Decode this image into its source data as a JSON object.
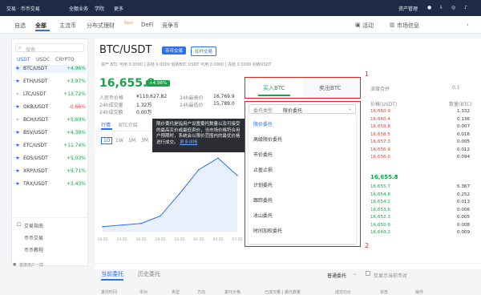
{
  "topnav": {
    "brand": "交易 · 币币交易",
    "items": [
      "全额业务",
      "学院",
      "更多"
    ],
    "right": [
      "资产管理"
    ]
  },
  "subnav": {
    "tabs": [
      "自选",
      "全部",
      "主流币",
      "分布式理财",
      "DeFi",
      "竞争币"
    ],
    "active": "全部",
    "badge_new": "New",
    "right": [
      "活动",
      "市场信息"
    ]
  },
  "market_list": {
    "search_placeholder": "搜索",
    "filters": [
      "USDT",
      "USDC",
      "CRYPTO"
    ],
    "rows": [
      {
        "sym": "BTC/USDT",
        "chg": "+4.96%",
        "dir": "up",
        "active": true,
        "starred": true
      },
      {
        "sym": "ETH/USDT",
        "chg": "+3.97%",
        "dir": "up",
        "starred": true
      },
      {
        "sym": "LTC/USDT",
        "chg": "+13.72%",
        "dir": "up"
      },
      {
        "sym": "OKB/USDT",
        "chg": "-0.66%",
        "dir": "down",
        "starred": true
      },
      {
        "sym": "BCH/USDT",
        "chg": "+5.69%",
        "dir": "up"
      },
      {
        "sym": "BSV/USDT",
        "chg": "+4.38%",
        "dir": "up",
        "starred": true
      },
      {
        "sym": "ETC/USDT",
        "chg": "+11.74%",
        "dir": "up",
        "starred": true
      },
      {
        "sym": "EOS/USDT",
        "chg": "+5.03%",
        "dir": "up",
        "starred": true
      },
      {
        "sym": "XRP/USDT",
        "chg": "+9.71%",
        "dir": "up",
        "starred": true
      },
      {
        "sym": "TRX/USDT",
        "chg": "+3.43%",
        "dir": "up",
        "starred": true
      }
    ],
    "footer_title": "交易指南",
    "footer_links": [
      "币币交易",
      "币币教程"
    ]
  },
  "header": {
    "pair": "BTC/USDT",
    "tag1": "币币交易",
    "tag2": "杠杆交易",
    "asset_line": "资产    BTC  可用 0.0000 | 冻结 0.0000  划转BTC    USDT  可用 0.0000 | 冻结 0.0000  划转USDT",
    "price": "16,655.8",
    "change": "+4.96%",
    "stats": [
      {
        "label": "人民币价格",
        "value": "¥110,627.82"
      },
      {
        "label": "24h成交量",
        "value": "1.32万"
      },
      {
        "label": "24h成交额",
        "value": "0.00万"
      }
    ],
    "stats2": [
      {
        "label": "24h最高价",
        "value": "16,769.9"
      },
      {
        "label": "24h最低价",
        "value": "15,789.0"
      }
    ]
  },
  "chart_tabs": {
    "tabs": [
      "行情",
      "BTC介绍"
    ],
    "intervals": [
      "1D",
      "1W",
      "1M",
      "3M"
    ]
  },
  "tooltip": {
    "text": "限价委托是指用户设置委托数量以及可接受的最高买价或最低卖价，当市场价格符合用户预期时，系统会以限价范围内的最优价格进行成交。",
    "link": "更多详情"
  },
  "order_panel": {
    "buy_tab": "买入BTC",
    "sell_tab": "卖出BTC",
    "type_label": "委托类型",
    "type_value": "限价委托",
    "options": [
      "限价委托",
      "高级限价委托",
      "市价委托",
      "止盈止损",
      "计划委托",
      "跟踪委托",
      "冰山委托",
      "时间加权委托"
    ],
    "annot1": "1",
    "annot2": "2"
  },
  "orderbook": {
    "title": "深度合并",
    "step": "0.1",
    "col_price": "价格(USDT)",
    "col_amount": "数量(BTC)",
    "asks": [
      [
        "16,660.9",
        "1.332"
      ],
      [
        "16,660.4",
        "0.136"
      ],
      [
        "16,659.8",
        "0.007"
      ],
      [
        "16,658.5",
        "0.016"
      ],
      [
        "16,657.3",
        "0.005"
      ],
      [
        "16,656.9",
        "0.012"
      ],
      [
        "16,656.0",
        "0.094"
      ]
    ],
    "last": "16,655.8",
    "last_arrow": "↑",
    "bids": [
      [
        "16,655.7",
        "5.367"
      ],
      [
        "16,654.8",
        "0.252"
      ],
      [
        "16,654.2",
        "0.013"
      ],
      [
        "16,653.6",
        "0.006"
      ],
      [
        "16,652.3",
        "0.005"
      ],
      [
        "16,650.8",
        "0.008"
      ],
      [
        "16,649.2",
        "0.009"
      ]
    ]
  },
  "orders": {
    "tabs": [
      "当前委托",
      "历史委托"
    ],
    "select": "普通委托",
    "checkbox_label": "仅显示当前币对",
    "cols": [
      "委托时间",
      "币对",
      "类型",
      "方向",
      "委托价格",
      "已成交量 | 委托数量",
      "成交均价",
      "状态",
      "操作"
    ]
  },
  "chart_data": {
    "type": "line",
    "x": [
      "10:25",
      "13:25",
      "16:25",
      "19:25",
      "22:25",
      "01:25",
      "04:25",
      "07:25"
    ],
    "values": [
      15860,
      15880,
      15900,
      15990,
      16260,
      16550,
      16690,
      16480
    ]
  },
  "bottom_user": "首度用户一样"
}
